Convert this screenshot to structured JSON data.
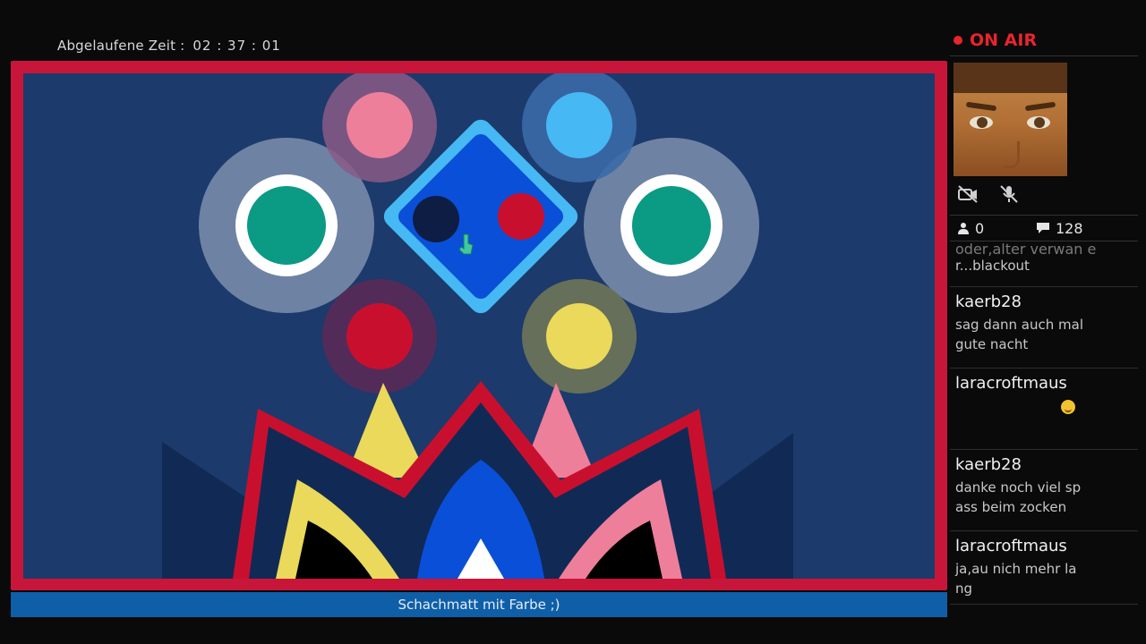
{
  "header": {
    "elapsed_label": "Abgelaufene Zeit :",
    "elapsed_time": "02 : 37 : 01"
  },
  "broadcast": {
    "status": "ON AIR",
    "viewers": "0",
    "comments": "128",
    "caption": "Schachmatt mit Farbe ;)"
  },
  "icons": {
    "camera_off": "camera-off-icon",
    "mic_off": "microphone-off-icon",
    "viewers": "person-icon",
    "comments": "speech-bubble-icon"
  },
  "colors": {
    "on_air": "#e8242e",
    "frame": "#c8163a",
    "scene_bg": "#1c3a6b",
    "caption_bar": "#0f5fa8",
    "teal": "#0b9a84",
    "pink": "#ee7f9a",
    "sky": "#46b8f4",
    "red": "#c8102e",
    "yellow": "#ead95a",
    "royal_blue": "#0a4fd8"
  },
  "chat": {
    "cut_line_top": "oder,alter verwan e",
    "cut_line": "r...blackout",
    "messages": [
      {
        "user": "kaerb28",
        "text": "sag dann auch mal\ngute nacht"
      },
      {
        "user": "laracroftmaus",
        "text": ""
      },
      {
        "user": "kaerb28",
        "text": "danke noch viel sp\nass beim zocken"
      },
      {
        "user": "laracroftmaus",
        "text": "ja,au nich mehr la\nng"
      }
    ]
  }
}
